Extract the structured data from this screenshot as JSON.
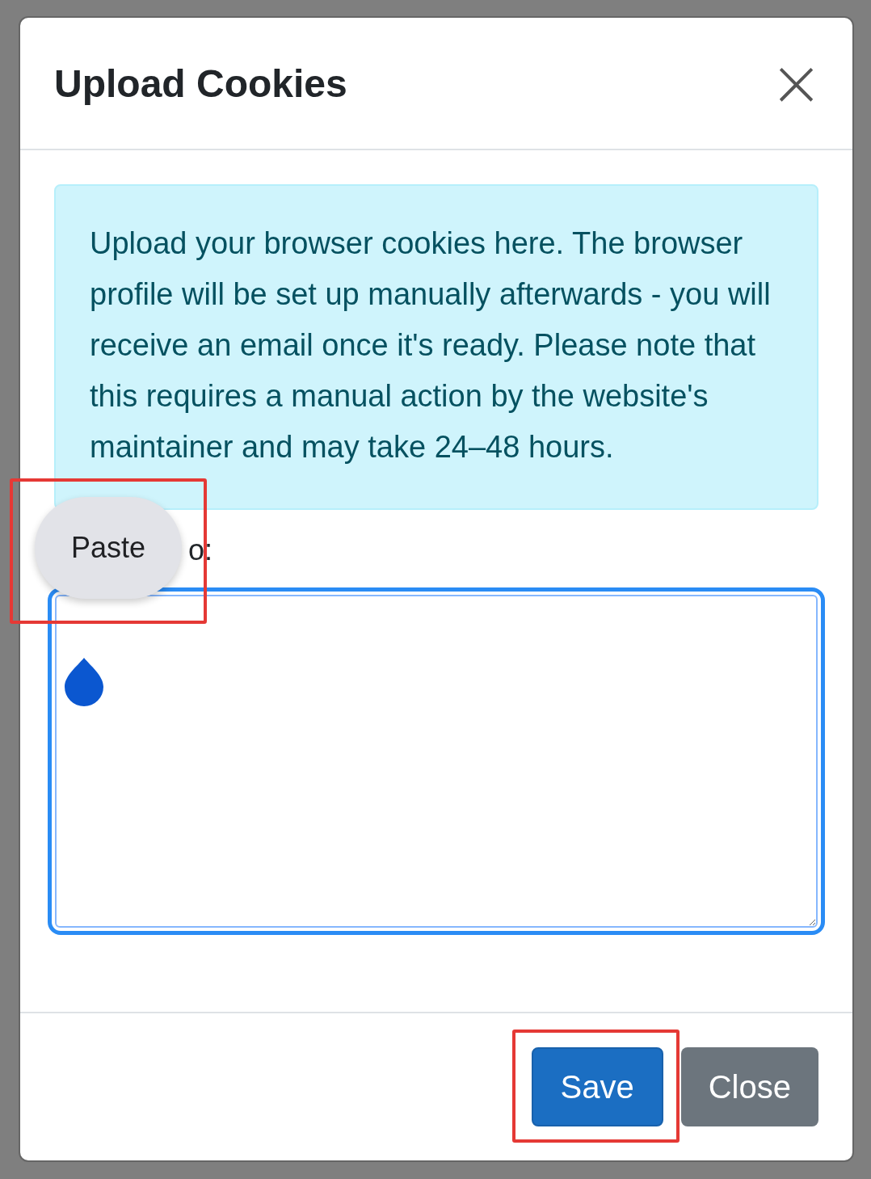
{
  "modal": {
    "title": "Upload Cookies",
    "close_symbol": "×",
    "alert": "Upload your browser cookies here. The browser profile will be set up manually afterwards - you will receive an email once it's ready. Please note that this requires a manual action by the website's maintainer and may take 24–48 hours.",
    "field_label": "o:",
    "textarea": {
      "focused": true
    },
    "buttons": [
      {
        "label": "Save",
        "kind": "primary",
        "highlighted": true
      },
      {
        "label": "Close",
        "kind": "secondary",
        "highlighted": false
      }
    ]
  },
  "context_menu": {
    "items": [
      "Paste"
    ],
    "highlighted": true
  }
}
